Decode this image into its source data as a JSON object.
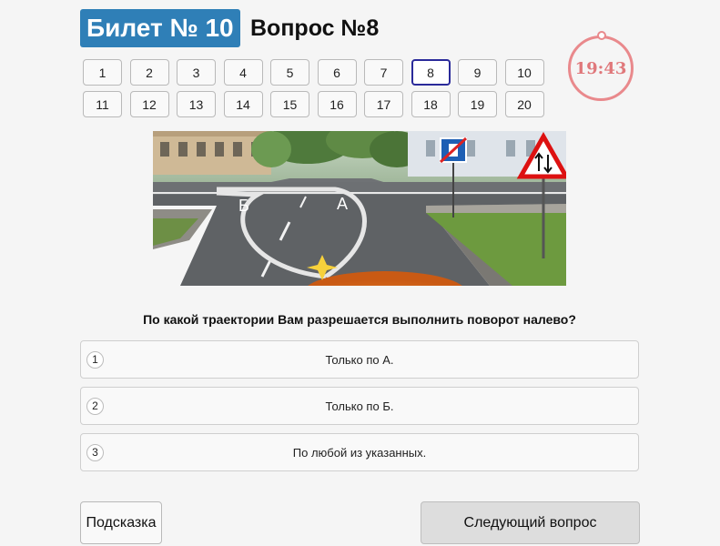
{
  "header": {
    "ticket_label": "Билет № 10",
    "question_label": "Вопрос №8"
  },
  "question_nav": {
    "current": 8,
    "items": [
      "1",
      "2",
      "3",
      "4",
      "5",
      "6",
      "7",
      "8",
      "9",
      "10",
      "11",
      "12",
      "13",
      "14",
      "15",
      "16",
      "17",
      "18",
      "19",
      "20"
    ]
  },
  "timer": {
    "value": "19:43",
    "color": "#e9898c"
  },
  "scene": {
    "label_a": "А",
    "label_b": "Б",
    "signs": [
      "end-of-one-way-road-sign",
      "two-way-traffic-warning-sign"
    ]
  },
  "question": {
    "text": "По какой траектории Вам разрешается выполнить поворот налево?"
  },
  "answers": [
    {
      "number": "1",
      "text": "Только по А."
    },
    {
      "number": "2",
      "text": "Только по Б."
    },
    {
      "number": "3",
      "text": "По любой из указанных."
    }
  ],
  "buttons": {
    "hint": "Подсказка",
    "next": "Следующий вопрос"
  },
  "colors": {
    "badge": "#2f7fb7",
    "current_border": "#2a2a9a"
  }
}
